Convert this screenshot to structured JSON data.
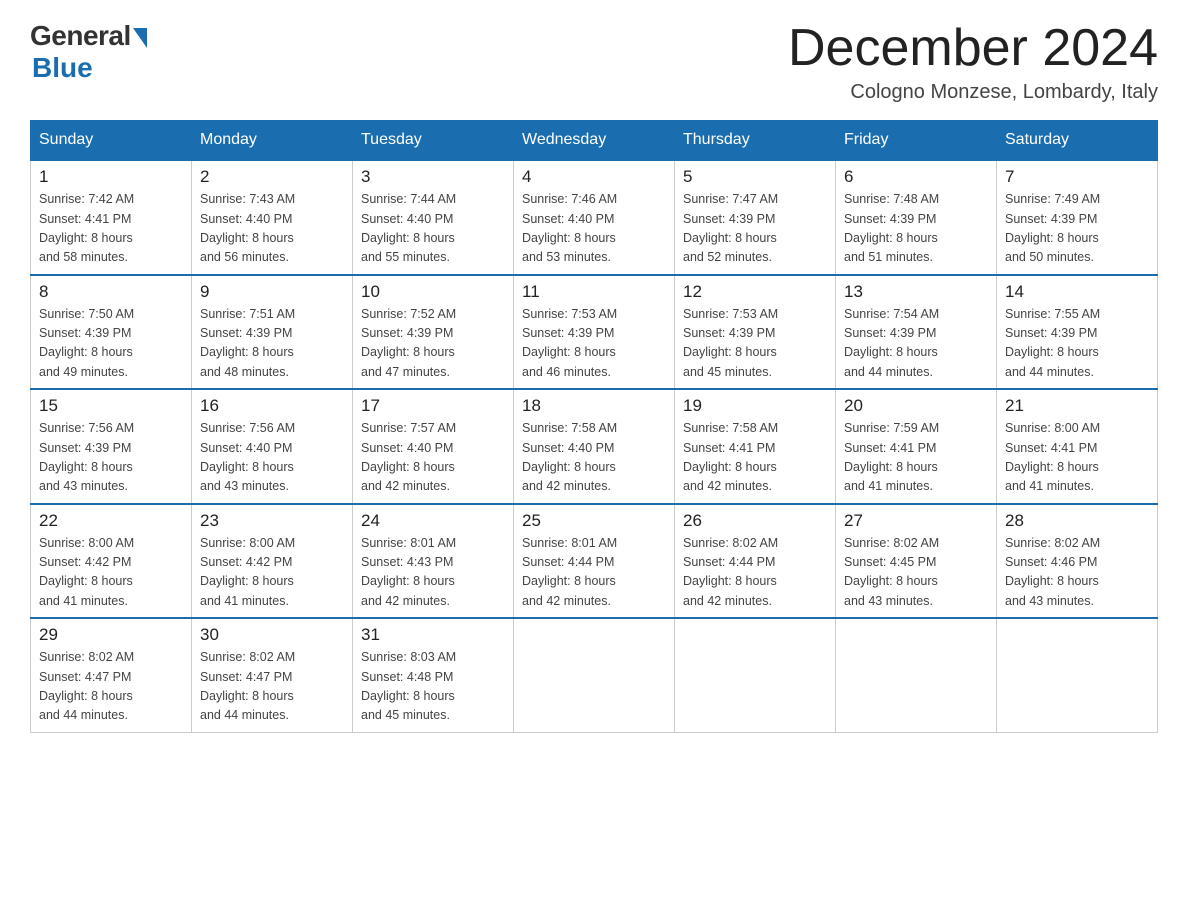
{
  "header": {
    "logo_general": "General",
    "logo_blue": "Blue",
    "month_title": "December 2024",
    "location": "Cologno Monzese, Lombardy, Italy"
  },
  "days_of_week": [
    "Sunday",
    "Monday",
    "Tuesday",
    "Wednesday",
    "Thursday",
    "Friday",
    "Saturday"
  ],
  "weeks": [
    [
      {
        "day": "1",
        "sunrise": "7:42 AM",
        "sunset": "4:41 PM",
        "daylight": "8 hours and 58 minutes."
      },
      {
        "day": "2",
        "sunrise": "7:43 AM",
        "sunset": "4:40 PM",
        "daylight": "8 hours and 56 minutes."
      },
      {
        "day": "3",
        "sunrise": "7:44 AM",
        "sunset": "4:40 PM",
        "daylight": "8 hours and 55 minutes."
      },
      {
        "day": "4",
        "sunrise": "7:46 AM",
        "sunset": "4:40 PM",
        "daylight": "8 hours and 53 minutes."
      },
      {
        "day": "5",
        "sunrise": "7:47 AM",
        "sunset": "4:39 PM",
        "daylight": "8 hours and 52 minutes."
      },
      {
        "day": "6",
        "sunrise": "7:48 AM",
        "sunset": "4:39 PM",
        "daylight": "8 hours and 51 minutes."
      },
      {
        "day": "7",
        "sunrise": "7:49 AM",
        "sunset": "4:39 PM",
        "daylight": "8 hours and 50 minutes."
      }
    ],
    [
      {
        "day": "8",
        "sunrise": "7:50 AM",
        "sunset": "4:39 PM",
        "daylight": "8 hours and 49 minutes."
      },
      {
        "day": "9",
        "sunrise": "7:51 AM",
        "sunset": "4:39 PM",
        "daylight": "8 hours and 48 minutes."
      },
      {
        "day": "10",
        "sunrise": "7:52 AM",
        "sunset": "4:39 PM",
        "daylight": "8 hours and 47 minutes."
      },
      {
        "day": "11",
        "sunrise": "7:53 AM",
        "sunset": "4:39 PM",
        "daylight": "8 hours and 46 minutes."
      },
      {
        "day": "12",
        "sunrise": "7:53 AM",
        "sunset": "4:39 PM",
        "daylight": "8 hours and 45 minutes."
      },
      {
        "day": "13",
        "sunrise": "7:54 AM",
        "sunset": "4:39 PM",
        "daylight": "8 hours and 44 minutes."
      },
      {
        "day": "14",
        "sunrise": "7:55 AM",
        "sunset": "4:39 PM",
        "daylight": "8 hours and 44 minutes."
      }
    ],
    [
      {
        "day": "15",
        "sunrise": "7:56 AM",
        "sunset": "4:39 PM",
        "daylight": "8 hours and 43 minutes."
      },
      {
        "day": "16",
        "sunrise": "7:56 AM",
        "sunset": "4:40 PM",
        "daylight": "8 hours and 43 minutes."
      },
      {
        "day": "17",
        "sunrise": "7:57 AM",
        "sunset": "4:40 PM",
        "daylight": "8 hours and 42 minutes."
      },
      {
        "day": "18",
        "sunrise": "7:58 AM",
        "sunset": "4:40 PM",
        "daylight": "8 hours and 42 minutes."
      },
      {
        "day": "19",
        "sunrise": "7:58 AM",
        "sunset": "4:41 PM",
        "daylight": "8 hours and 42 minutes."
      },
      {
        "day": "20",
        "sunrise": "7:59 AM",
        "sunset": "4:41 PM",
        "daylight": "8 hours and 41 minutes."
      },
      {
        "day": "21",
        "sunrise": "8:00 AM",
        "sunset": "4:41 PM",
        "daylight": "8 hours and 41 minutes."
      }
    ],
    [
      {
        "day": "22",
        "sunrise": "8:00 AM",
        "sunset": "4:42 PM",
        "daylight": "8 hours and 41 minutes."
      },
      {
        "day": "23",
        "sunrise": "8:00 AM",
        "sunset": "4:42 PM",
        "daylight": "8 hours and 41 minutes."
      },
      {
        "day": "24",
        "sunrise": "8:01 AM",
        "sunset": "4:43 PM",
        "daylight": "8 hours and 42 minutes."
      },
      {
        "day": "25",
        "sunrise": "8:01 AM",
        "sunset": "4:44 PM",
        "daylight": "8 hours and 42 minutes."
      },
      {
        "day": "26",
        "sunrise": "8:02 AM",
        "sunset": "4:44 PM",
        "daylight": "8 hours and 42 minutes."
      },
      {
        "day": "27",
        "sunrise": "8:02 AM",
        "sunset": "4:45 PM",
        "daylight": "8 hours and 43 minutes."
      },
      {
        "day": "28",
        "sunrise": "8:02 AM",
        "sunset": "4:46 PM",
        "daylight": "8 hours and 43 minutes."
      }
    ],
    [
      {
        "day": "29",
        "sunrise": "8:02 AM",
        "sunset": "4:47 PM",
        "daylight": "8 hours and 44 minutes."
      },
      {
        "day": "30",
        "sunrise": "8:02 AM",
        "sunset": "4:47 PM",
        "daylight": "8 hours and 44 minutes."
      },
      {
        "day": "31",
        "sunrise": "8:03 AM",
        "sunset": "4:48 PM",
        "daylight": "8 hours and 45 minutes."
      },
      null,
      null,
      null,
      null
    ]
  ],
  "labels": {
    "sunrise": "Sunrise:",
    "sunset": "Sunset:",
    "daylight": "Daylight:"
  }
}
